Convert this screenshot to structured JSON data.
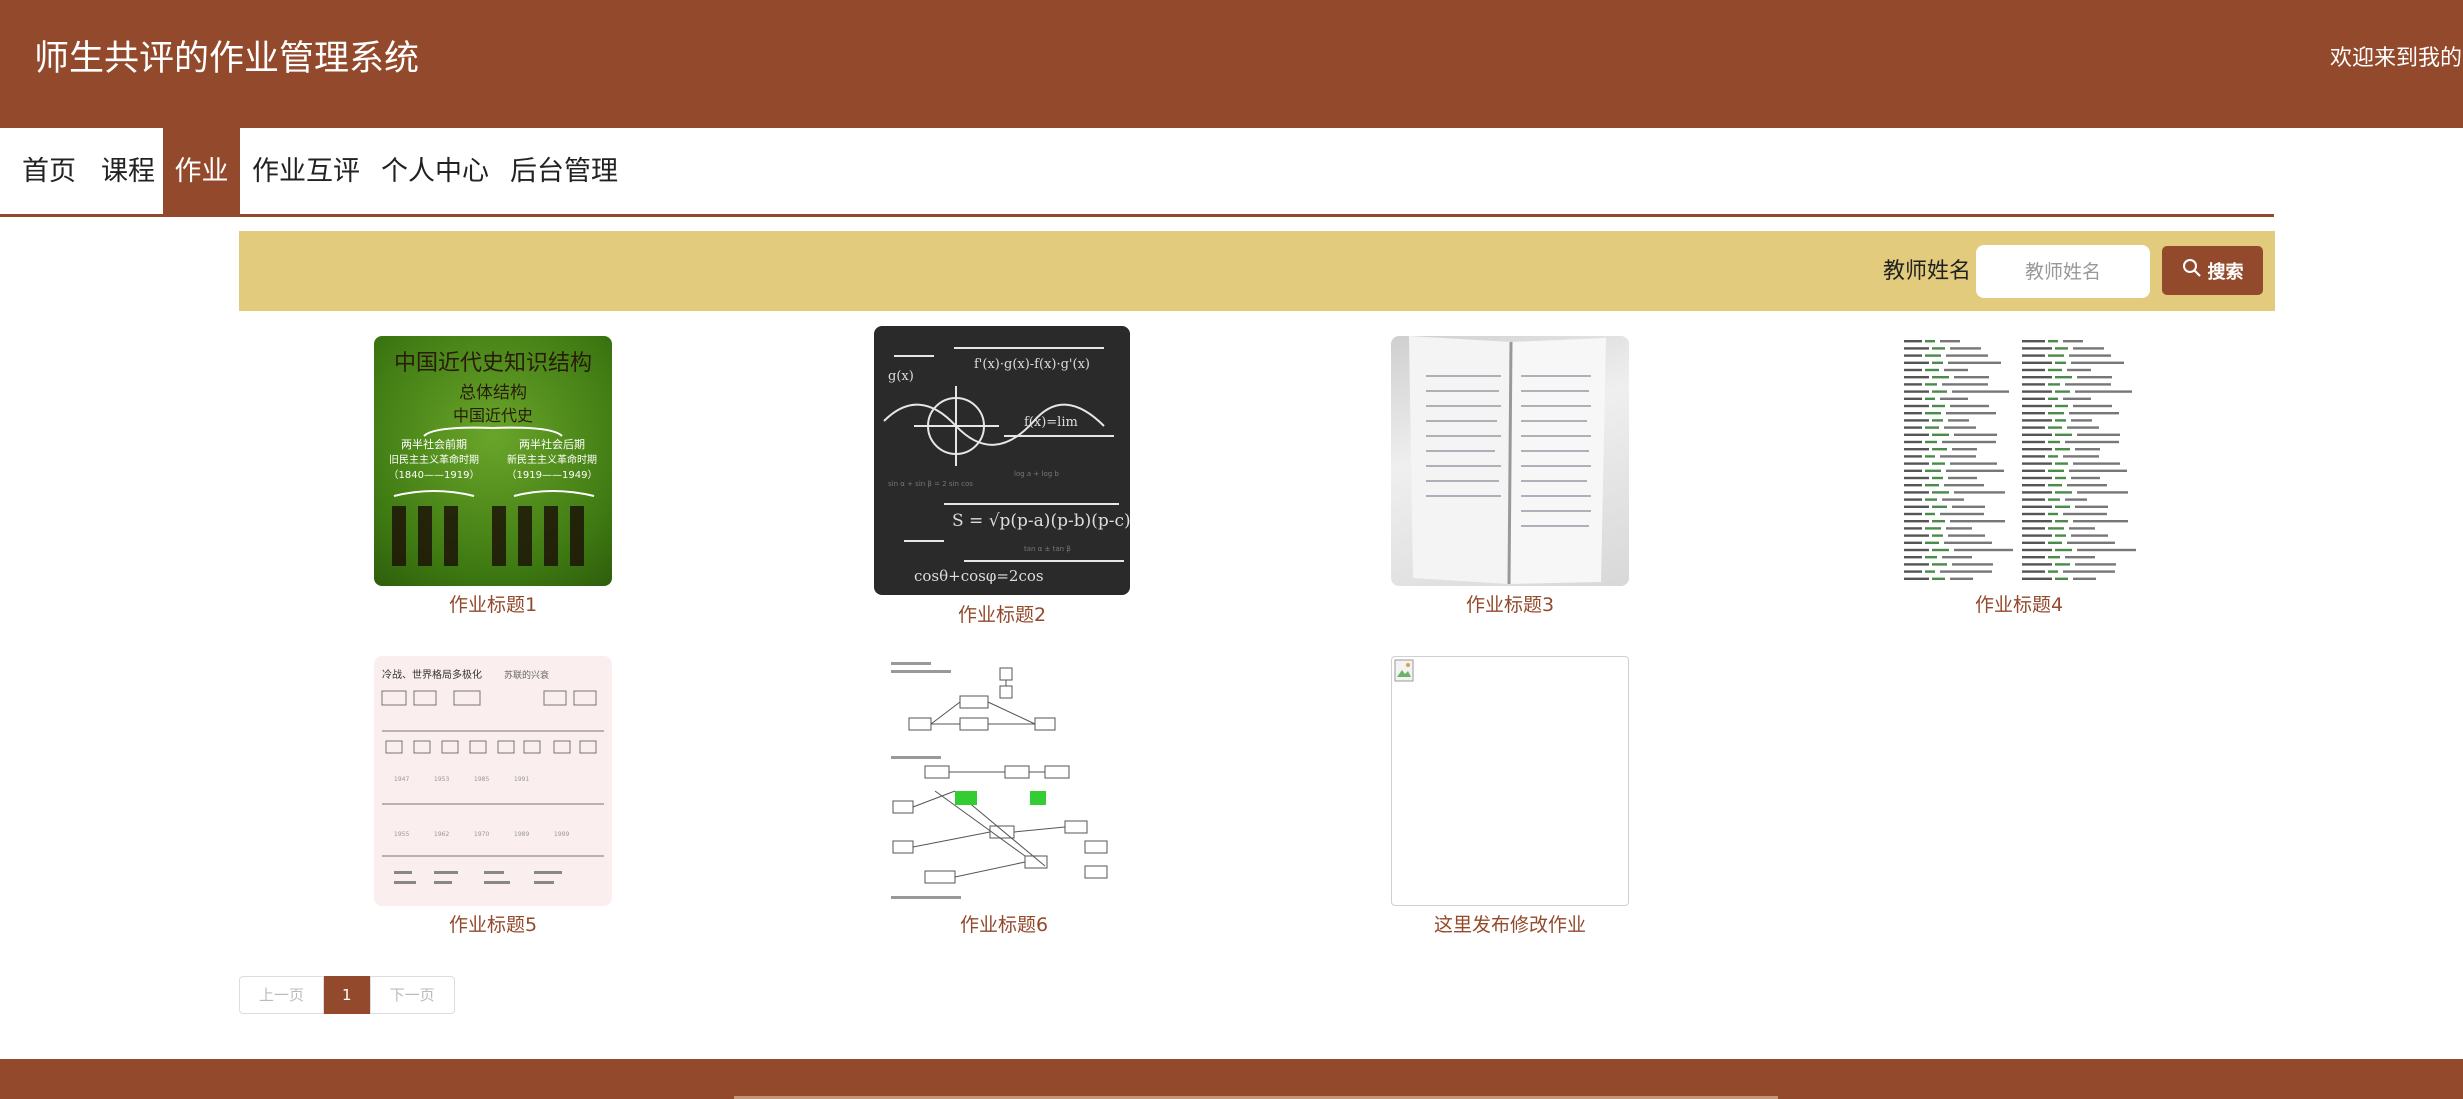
{
  "header": {
    "title": "师生共评的作业管理系统",
    "welcome": "欢迎来到我的网"
  },
  "nav": {
    "items": [
      {
        "label": "首页"
      },
      {
        "label": "课程"
      },
      {
        "label": "作业",
        "active": true
      },
      {
        "label": "作业互评"
      },
      {
        "label": "个人中心"
      },
      {
        "label": "后台管理"
      }
    ]
  },
  "search": {
    "label": "教师姓名",
    "placeholder": "教师姓名",
    "button_label": "搜索"
  },
  "homework": [
    {
      "title": "作业标题1",
      "thumb": "中国近代史知识结构"
    },
    {
      "title": "作业标题2",
      "thumb": "math formulas blackboard"
    },
    {
      "title": "作业标题3",
      "thumb": "notebook photo"
    },
    {
      "title": "作业标题4",
      "thumb": "vocabulary list"
    },
    {
      "title": "作业标题5",
      "thumb": "冷战、世界格局多极化"
    },
    {
      "title": "作业标题6",
      "thumb": "flowchart diagram"
    },
    {
      "title": "这里发布修改作业",
      "thumb": "broken image"
    }
  ],
  "thumb_text": {
    "t1_title": "中国近代史知识结构",
    "t1_sub1": "总体结构",
    "t1_sub2": "中国近代史",
    "t1_l": "两半社会前期",
    "t1_l2": "旧民主主义革命时期",
    "t1_l3": "（1840——1919）",
    "t1_r": "两半社会后期",
    "t1_r2": "新民主主义革命时期",
    "t1_r3": "（1919——1949）",
    "t5_title": "冷战、世界格局多极化",
    "t5_sub": "苏联的兴衰"
  },
  "pagination": {
    "prev": "上一页",
    "current": "1",
    "next": "下一页"
  },
  "colors": {
    "brand": "#934a2c",
    "search_bar": "#e2cb7c"
  }
}
